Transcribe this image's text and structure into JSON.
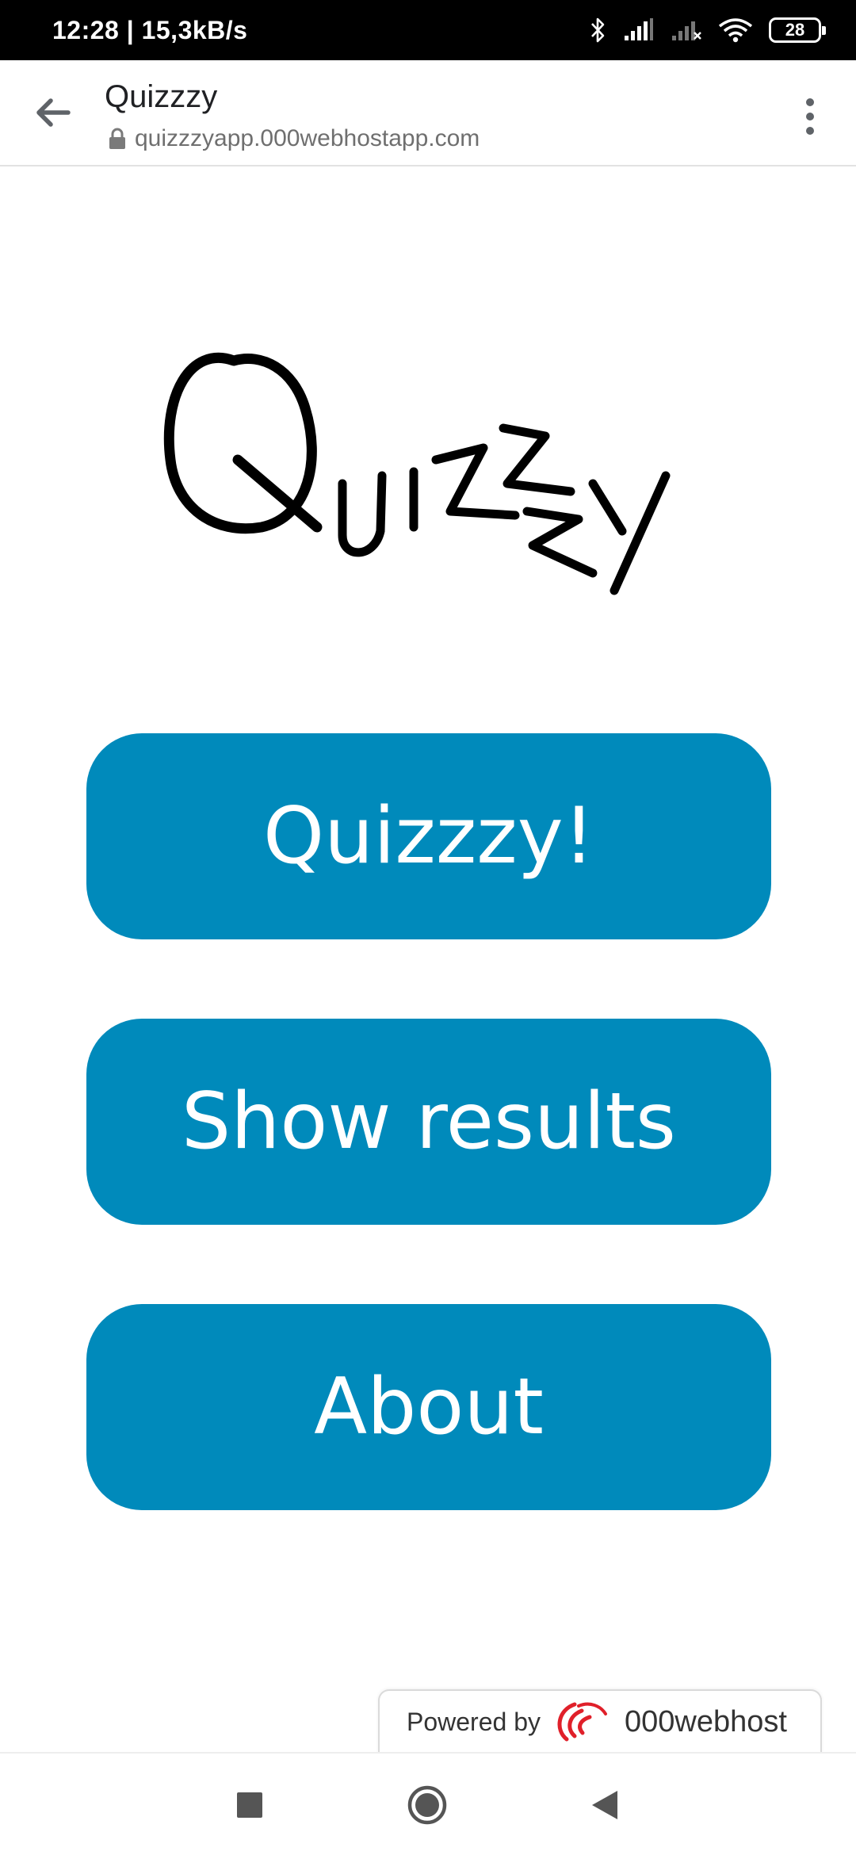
{
  "status_bar": {
    "time_speed": "12:28 | 15,3kB/s",
    "battery_level": "28"
  },
  "browser": {
    "page_title": "Quizzzy",
    "url": "quizzzyapp.000webhostapp.com"
  },
  "logo": {
    "text": "Quizzzy"
  },
  "buttons": {
    "quiz": "Quizzzy!",
    "results": "Show results",
    "about": "About"
  },
  "footer": {
    "powered_by": "Powered by",
    "host": "000webhost"
  },
  "colors": {
    "button_bg": "#008abb",
    "button_text": "#ffffff",
    "status_bar_bg": "#000000"
  },
  "icons": {
    "back": "arrow-left-icon",
    "lock": "lock-icon",
    "menu": "more-vert-icon",
    "bluetooth": "bluetooth-icon",
    "signal": "signal-icon",
    "wifi": "wifi-icon",
    "nav_recents": "square-icon",
    "nav_home": "circle-icon",
    "nav_back": "triangle-back-icon"
  }
}
